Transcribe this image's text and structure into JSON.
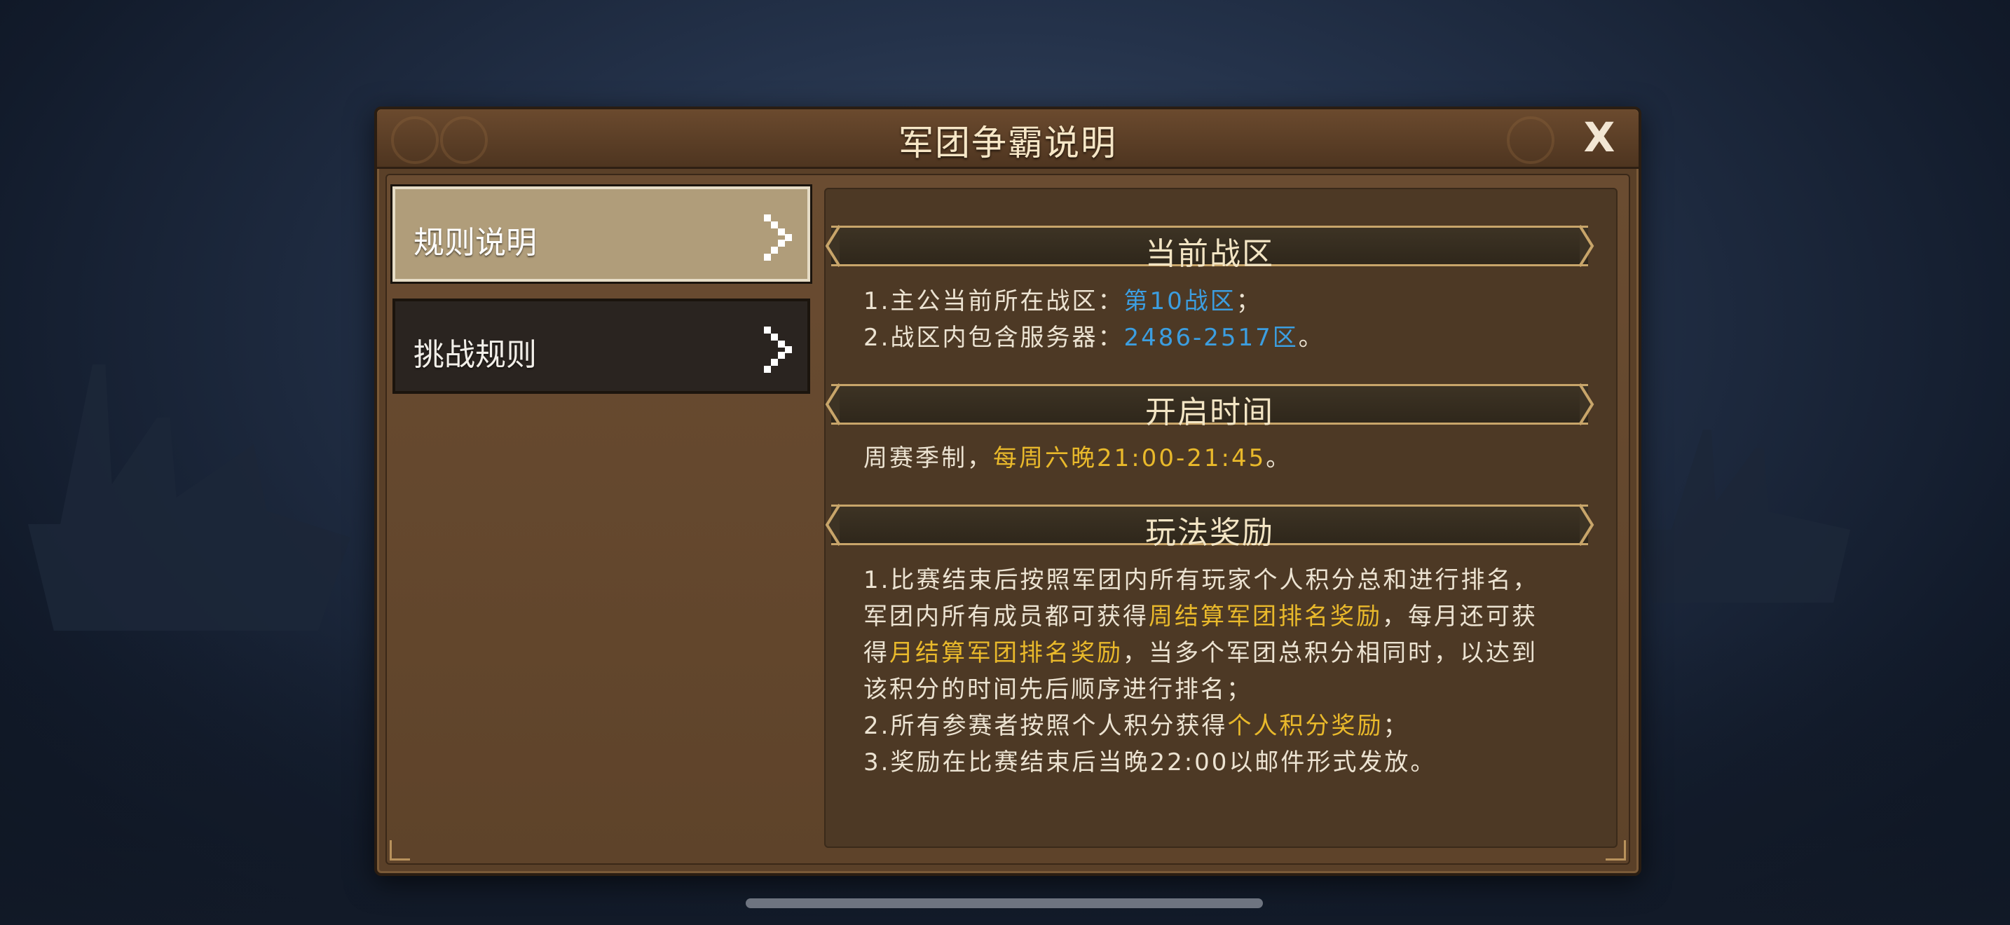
{
  "dialog": {
    "title": "军团争霸说明",
    "close_label": "X"
  },
  "nav": {
    "items": [
      {
        "label": "规则说明",
        "active": true
      },
      {
        "label": "挑战规则",
        "active": false
      }
    ]
  },
  "sections": {
    "zone": {
      "header": "当前战区",
      "line1_prefix": "1.主公当前所在战区：",
      "line1_value": "第10战区",
      "line1_suffix": "；",
      "line2_prefix": "2.战区内包含服务器：",
      "line2_value": "2486-2517区",
      "line2_suffix": "。"
    },
    "time": {
      "header": "开启时间",
      "prefix": "周赛季制，",
      "value": "每周六晚21:00-21:45",
      "suffix": "。"
    },
    "reward": {
      "header": "玩法奖励",
      "p1_a": "1.比赛结束后按照军团内所有玩家个人积分总和进行排名，军团内所有成员都可获得",
      "p1_b": "周结算军团排名奖励",
      "p1_c": "，每月还可获得",
      "p1_d": "月结算军团排名奖励",
      "p1_e": "，当多个军团总积分相同时，以达到该积分的时间先后顺序进行排名；",
      "p2_a": "2.所有参赛者按照个人积分获得",
      "p2_b": "个人积分奖励",
      "p2_c": "；",
      "p3": "3.奖励在比赛结束后当晚22:00以邮件形式发放。"
    }
  },
  "colors": {
    "highlight_blue": "#3c9ee0",
    "highlight_gold": "#e9b92b",
    "text_main": "#ece3d2",
    "dialog_brown": "#5a4028"
  },
  "icons": {
    "close": "close-icon",
    "chevron": "chevron-right-icon"
  }
}
